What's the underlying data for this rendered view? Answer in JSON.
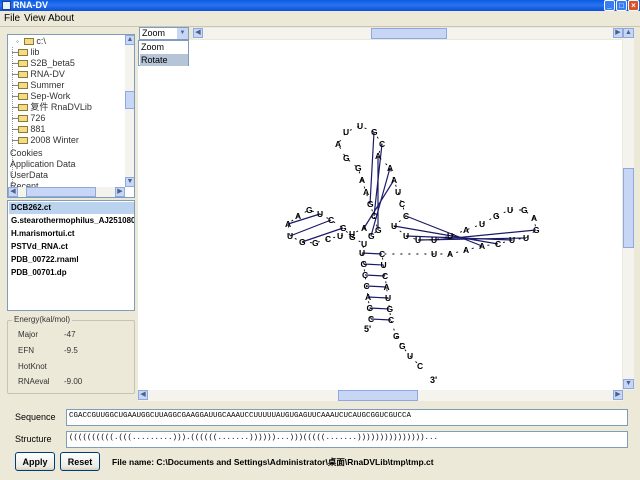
{
  "window": {
    "title": "RNA-DV"
  },
  "menu": [
    "File",
    "View",
    "About"
  ],
  "tree": {
    "root": "c:\\",
    "items": [
      "lib",
      "S2B_beta5",
      "RNA-DV",
      "Summer",
      "Sep-Work",
      "复件 RnaDVLib",
      "726",
      "881",
      "2008 Winter"
    ],
    "extra": [
      "Cookies",
      "Application Data",
      "UserData",
      "Recent"
    ]
  },
  "files": [
    "DCB262.ct",
    "G.stearothermophilus_AJ251080.ct",
    "H.marismortui.ct",
    "PSTVd_RNA.ct",
    "PDB_00722.rnaml",
    "PDB_00701.dp"
  ],
  "energy": {
    "title": "Energy(kal/mol)",
    "rows": [
      {
        "label": "Major",
        "value": "-47"
      },
      {
        "label": "EFN",
        "value": "-9.5"
      },
      {
        "label": "HotKnot",
        "value": ""
      },
      {
        "label": "RNAeval",
        "value": "-9.00"
      }
    ]
  },
  "view_mode": {
    "selected": "Zoom",
    "options": [
      "Zoom",
      "Rotate"
    ]
  },
  "structure_labels": {
    "five_prime": "5'",
    "three_prime": "3'"
  },
  "sequence": {
    "label": "Sequence",
    "value": "CGACCGUUGGCUGAAUGGCUUAGGCGAAGGAUUGCAAAUCCUUUUUAUGUGAGUUCAAAUCUCAUGCGGUCGUCCA"
  },
  "structure": {
    "label": "Structure",
    "value": "((((((((((.(((.........))).((((((.......))))))...)))(((((.......)))))))))))))))..."
  },
  "buttons": {
    "apply": "Apply",
    "reset": "Reset"
  },
  "status": {
    "file_name": "File name: C:\\Documents and Settings\\Administrator\\桌面\\RnaDVLib\\tmp\\tmp.ct"
  },
  "colors": {
    "accent": "#0a5ce3",
    "selection": "#bcd3f0"
  }
}
